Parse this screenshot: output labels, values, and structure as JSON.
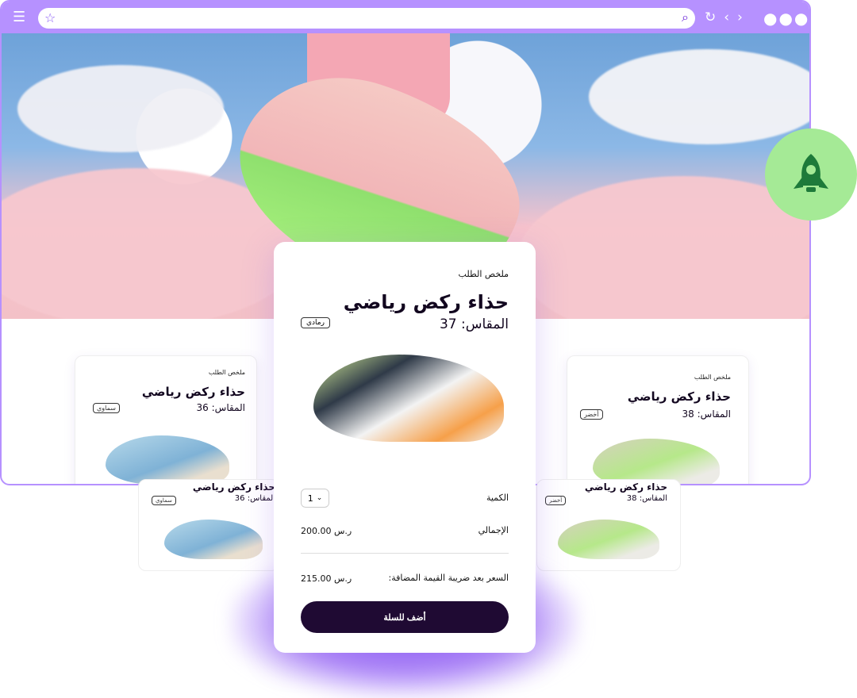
{
  "browser": {
    "toolbar": {
      "menu_icon": "menu-icon",
      "star_icon": "star-icon",
      "search_icon": "search-icon",
      "reload_icon": "reload-icon",
      "back_icon": "back-icon",
      "forward_icon": "forward-icon",
      "more_icon": "more-icon"
    }
  },
  "main_card": {
    "summary_label": "ملخص الطلب",
    "title": "حذاء ركض رياضي",
    "size": "المقاس: 37",
    "color": "رمادي",
    "quantity_label": "الكمية",
    "quantity_value": "1",
    "total_label": "الإجمالي",
    "total_value": "200.00 ر.س",
    "vat_label": "السعر بعد ضريبة القيمة المضافة:",
    "vat_value": "215.00 ر.س",
    "button": "أضف للسلة"
  },
  "left_card": {
    "summary_label": "ملخص الطلب",
    "title": "حذاء ركض رياضي",
    "size": "المقاس: 36",
    "color": "سماوي"
  },
  "right_card": {
    "summary_label": "ملخص الطلب",
    "title": "حذاء ركض رياضي",
    "size": "المقاس: 38",
    "color": "أخضر"
  },
  "left_card_small": {
    "title": "حذاء ركض رياضي",
    "size": "المقاس: 36",
    "color": "سماوي"
  },
  "right_card_small": {
    "title": "حذاء ركض رياضي",
    "size": "المقاس: 38",
    "color": "أخضر"
  },
  "colors": {
    "accent": "#b691ff",
    "button": "#1f0a33",
    "rocket_bg": "#a5ea96",
    "rocket": "#1e7a3a"
  }
}
